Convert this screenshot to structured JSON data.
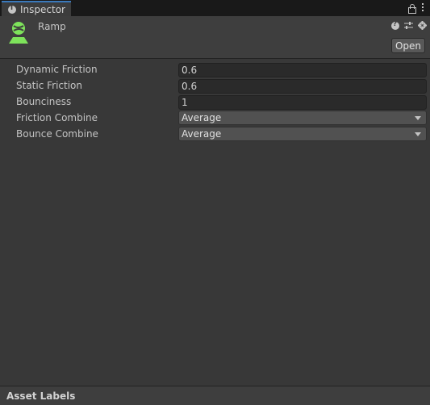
{
  "tab": {
    "title": "Inspector",
    "icon": "info-icon"
  },
  "tabbar_icons": [
    "lock-icon",
    "kebab-menu-icon"
  ],
  "header": {
    "asset_name": "Ramp",
    "asset_icon": "physic-material-icon",
    "asset_icon_color": "#7ee35b",
    "icons": [
      "help-icon",
      "preset-sliders-icon",
      "gear-icon"
    ],
    "open_label": "Open"
  },
  "properties": [
    {
      "label": "Dynamic Friction",
      "value": "0.6",
      "kind": "number"
    },
    {
      "label": "Static Friction",
      "value": "0.6",
      "kind": "number"
    },
    {
      "label": "Bounciness",
      "value": "1",
      "kind": "number"
    },
    {
      "label": "Friction Combine",
      "value": "Average",
      "kind": "dropdown"
    },
    {
      "label": "Bounce Combine",
      "value": "Average",
      "kind": "dropdown"
    }
  ],
  "footer": {
    "title": "Asset Labels"
  },
  "colors": {
    "background": "#383838",
    "tab_accent": "#3a79bb"
  }
}
